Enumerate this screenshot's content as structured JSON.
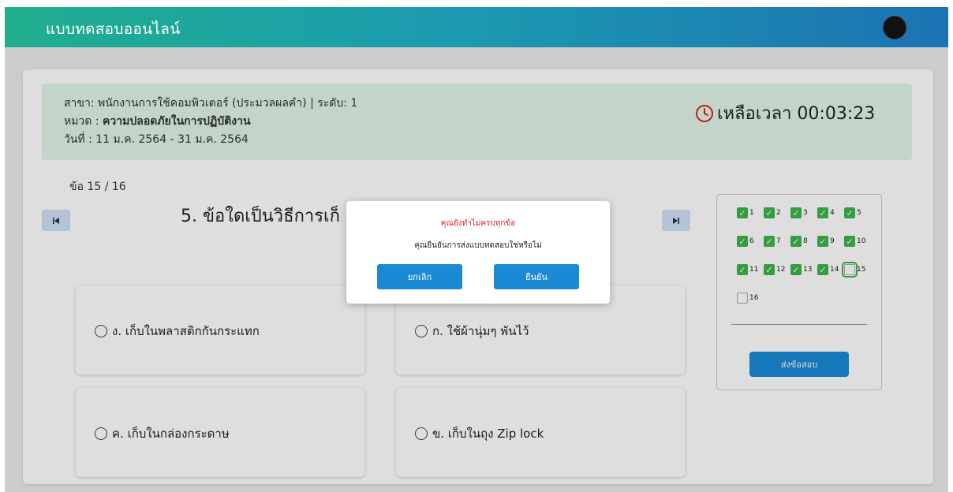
{
  "header": {
    "title": "แบบทดสอบออนไลน์"
  },
  "info": {
    "branch": "สาขา: พนักงานการใช้คอมพิวเตอร์ (ประมวลผลคำ) | ระดับ: 1",
    "category_label": "หมวด :",
    "category_value": "ความปลอดภัยในการปฏิบัติงาน",
    "date": "วันที่ : 11 ม.ค. 2564 - 31 ม.ค. 2564",
    "timer_text": "เหลือเวลา 00:03:23"
  },
  "progress": "ข้อ 15 / 16",
  "question": {
    "text": "5. ข้อใดเป็นวิธีการเก็"
  },
  "nav": {
    "prev_icon": "skip-previous-icon",
    "next_icon": "skip-next-icon"
  },
  "options": [
    {
      "label": "ง. เก็บในพลาสติกกันกระแทก"
    },
    {
      "label": "ก. ใช้ผ้านุ่มๆ พันไว้"
    },
    {
      "label": "ค. เก็บในกล่องกระดาษ"
    },
    {
      "label": "ข. เก็บในถุง Zip lock"
    }
  ],
  "answer_sheet": {
    "items": [
      {
        "n": "1",
        "checked": true
      },
      {
        "n": "2",
        "checked": true
      },
      {
        "n": "3",
        "checked": true
      },
      {
        "n": "4",
        "checked": true
      },
      {
        "n": "5",
        "checked": true
      },
      {
        "n": "6",
        "checked": true
      },
      {
        "n": "7",
        "checked": true
      },
      {
        "n": "8",
        "checked": true
      },
      {
        "n": "9",
        "checked": true
      },
      {
        "n": "10",
        "checked": true
      },
      {
        "n": "11",
        "checked": true
      },
      {
        "n": "12",
        "checked": true
      },
      {
        "n": "13",
        "checked": true
      },
      {
        "n": "14",
        "checked": true
      },
      {
        "n": "15",
        "checked": false
      },
      {
        "n": "16",
        "checked": false
      }
    ],
    "current": "15",
    "submit_label": "ส่งข้อสอบ"
  },
  "modal": {
    "title": "คุณยังทำไม่ครบทุกข้อ",
    "message": "คุณยืนยันการส่งแบบทดสอบใช่หรือไม่",
    "cancel_label": "ยกเลิก",
    "confirm_label": "ยืนยัน"
  },
  "colors": {
    "header_start": "#1fae8c",
    "header_end": "#1b73b3",
    "info_bg": "#dff5e6",
    "primary": "#1a8ad4",
    "checked": "#3cb54a",
    "warning": "#e02020"
  }
}
